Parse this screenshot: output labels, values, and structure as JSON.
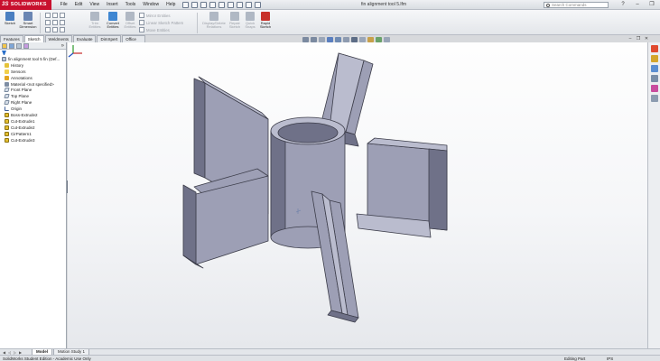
{
  "app": {
    "brand": "SOLIDWORKS",
    "menu": [
      "File",
      "Edit",
      "View",
      "Insert",
      "Tools",
      "Window",
      "Help"
    ],
    "document_title": "fin alignment tool 5.lfm",
    "search_placeholder": "Search Commands",
    "window_buttons": [
      "?",
      "–",
      "❐",
      "✕"
    ]
  },
  "command_manager": {
    "tools": [
      {
        "label": "Sketch",
        "enabled": true,
        "color": "#4a7fc1"
      },
      {
        "label": "Smart Dimension",
        "enabled": true,
        "color": "#6a86b3"
      },
      {
        "label": "Trim Entities",
        "enabled": false,
        "color": "#b0b8c4"
      },
      {
        "label": "Convert Entities",
        "enabled": true,
        "color": "#3e86d2"
      },
      {
        "label": "Offset Entities",
        "enabled": false,
        "color": "#b0b8c4"
      },
      {
        "label": "Display/Delete Relations",
        "enabled": false,
        "color": "#b0b8c4"
      },
      {
        "label": "Repair Sketch",
        "enabled": false,
        "color": "#b0b8c4"
      },
      {
        "label": "Quick Snaps",
        "enabled": false,
        "color": "#b0b8c4"
      },
      {
        "label": "Rapid Sketch",
        "enabled": true,
        "color": "#c8312a"
      }
    ],
    "small_tools": [
      "Mirror Entities",
      "Linear Sketch Pattern",
      "Move Entities"
    ]
  },
  "tabs": [
    "Features",
    "Sketch",
    "Weldments",
    "Evaluate",
    "DimXpert",
    "Office Products"
  ],
  "active_tab": "Sketch",
  "feature_tree": {
    "root": "fin alignment tool 5 fin  (Def...",
    "items": [
      {
        "label": "History",
        "icon": "history-icon"
      },
      {
        "label": "Sensors",
        "icon": "sensors-icon"
      },
      {
        "label": "Annotations",
        "icon": "annotations-icon"
      },
      {
        "label": "Material <not specified>",
        "icon": "material-icon"
      },
      {
        "label": "Front Plane",
        "icon": "plane-icon"
      },
      {
        "label": "Top Plane",
        "icon": "plane-icon"
      },
      {
        "label": "Right Plane",
        "icon": "plane-icon"
      },
      {
        "label": "Origin",
        "icon": "origin-icon"
      },
      {
        "label": "Boss-Extrude2",
        "icon": "boss-extrude-icon"
      },
      {
        "label": "Cut-Extrude1",
        "icon": "cut-extrude-icon"
      },
      {
        "label": "Cut-Extrude2",
        "icon": "cut-extrude-icon"
      },
      {
        "label": "CirPattern1",
        "icon": "circular-pattern-icon"
      },
      {
        "label": "Cut-Extrude3",
        "icon": "cut-extrude-icon"
      }
    ]
  },
  "model": {
    "face_color": "#9d9fb5",
    "light_color": "#babcce",
    "dark_color": "#6f7188",
    "edge_color": "#3c3d4a"
  },
  "bottom_tabs": [
    "Model",
    "Motion Study 1"
  ],
  "active_bottom_tab": "Model",
  "status_bar": {
    "left": "SolidWorks Student Edition - Academic Use Only",
    "mode": "Editing Part",
    "units": "IPS"
  }
}
